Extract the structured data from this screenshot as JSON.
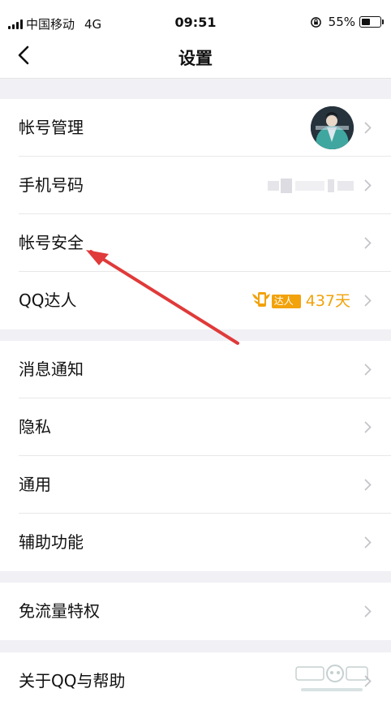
{
  "status_bar": {
    "carrier": "中国移动",
    "network": "4G",
    "time": "09:51",
    "battery": "55%",
    "battery_level": 0.55
  },
  "nav": {
    "title": "设置",
    "back_icon": "chevron-left-icon"
  },
  "groups": [
    {
      "items": [
        {
          "label": "帐号管理"
        },
        {
          "label": "手机号码"
        },
        {
          "label": "帐号安全"
        },
        {
          "label": "QQ达人",
          "badge": "达人",
          "days": "437天"
        }
      ]
    },
    {
      "items": [
        {
          "label": "消息通知"
        },
        {
          "label": "隐私"
        },
        {
          "label": "通用"
        },
        {
          "label": "辅助功能"
        }
      ]
    },
    {
      "items": [
        {
          "label": "免流量特权"
        }
      ]
    },
    {
      "items": [
        {
          "label": "关于QQ与帮助"
        }
      ]
    }
  ],
  "colors": {
    "accent": "#f2a20a",
    "arrow": "#e03a3a",
    "background": "#f0f0f5"
  }
}
